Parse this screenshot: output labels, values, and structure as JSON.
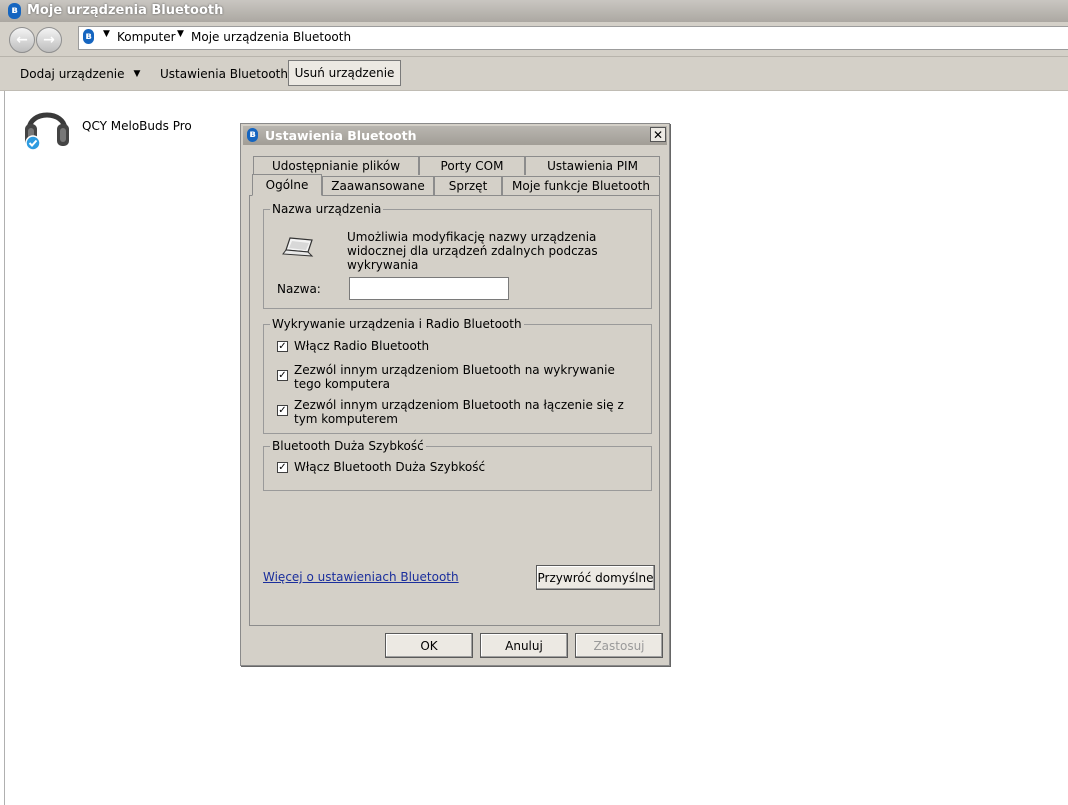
{
  "window": {
    "title": "Moje urządzenia Bluetooth"
  },
  "address": {
    "items": [
      "Komputer",
      "Moje urządzenia Bluetooth"
    ]
  },
  "toolbar": {
    "add_label": "Dodaj urządzenie",
    "settings_label": "Ustawienia Bluetooth",
    "remove_label": "Usuń urządzenie"
  },
  "device": {
    "name": "QCY MeloBuds Pro"
  },
  "dialog": {
    "title": "Ustawienia Bluetooth",
    "close_glyph": "✕",
    "tabs_row1": [
      "Udostępnianie plików",
      "Porty COM",
      "Ustawienia PIM"
    ],
    "tabs_row2": [
      "Ogólne",
      "Zaawansowane",
      "Sprzęt",
      "Moje funkcje Bluetooth"
    ],
    "active_tab": "Ogólne",
    "device_name_group": {
      "title": "Nazwa urządzenia",
      "description": "Umożliwia modyfikację nazwy urządzenia widocznej dla urządzeń zdalnych podczas wykrywania",
      "name_label": "Nazwa:",
      "name_value": ""
    },
    "discovery_group": {
      "title": "Wykrywanie urządzenia i Radio Bluetooth",
      "options": [
        {
          "label": "Włącz Radio Bluetooth",
          "checked": true
        },
        {
          "label": "Zezwól innym urządzeniom Bluetooth na wykrywanie tego komputera",
          "checked": true
        },
        {
          "label": "Zezwól innym urządzeniom Bluetooth na łączenie się z tym komputerem",
          "checked": true
        }
      ]
    },
    "high_speed_group": {
      "title": "Bluetooth Duża Szybkość",
      "options": [
        {
          "label": "Włącz Bluetooth Duża Szybkość",
          "checked": true
        }
      ]
    },
    "more_link": "Więcej o ustawieniach Bluetooth",
    "restore_button": "Przywróć domyślne",
    "ok_button": "OK",
    "cancel_button": "Anuluj",
    "apply_button": "Zastosuj"
  }
}
